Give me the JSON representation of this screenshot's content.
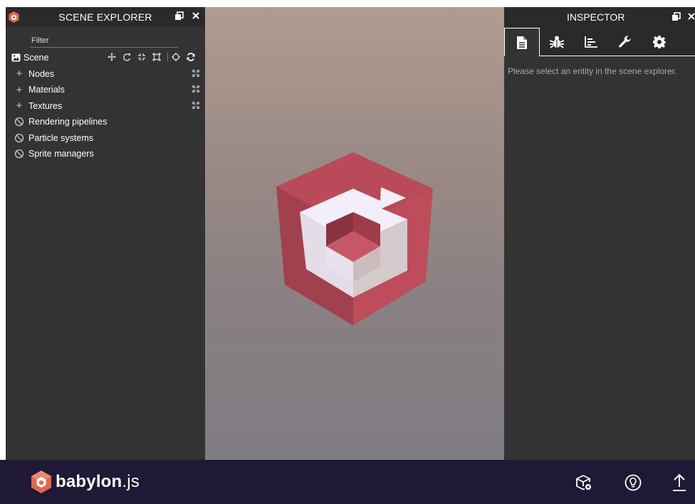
{
  "explorer": {
    "title": "SCENE EXPLORER",
    "filter_placeholder": "Filter",
    "scene_label": "Scene",
    "scene_tools": [
      "move-icon",
      "rotate-icon",
      "scale-icon",
      "bounding-box-icon",
      "target-icon",
      "refresh-icon"
    ],
    "items": [
      {
        "label": "Nodes",
        "type": "expandable"
      },
      {
        "label": "Materials",
        "type": "expandable"
      },
      {
        "label": "Textures",
        "type": "expandable"
      },
      {
        "label": "Rendering pipelines",
        "type": "disabled"
      },
      {
        "label": "Particle systems",
        "type": "disabled"
      },
      {
        "label": "Sprite managers",
        "type": "disabled"
      }
    ]
  },
  "inspector": {
    "title": "INSPECTOR",
    "tabs": [
      "properties-tab",
      "debug-tab",
      "statistics-tab",
      "tools-tab",
      "settings-tab"
    ],
    "active_tab": "properties-tab",
    "empty_message": "Please select an entity in the scene explorer."
  },
  "footer": {
    "brand_bold": "babylon",
    "brand_suffix": ".js",
    "actions": [
      "cube-settings-icon",
      "lightbulb-icon",
      "upload-icon"
    ]
  },
  "colors": {
    "panel_bg": "#333333",
    "header_bg": "#2a2a2a",
    "footer_bg": "#201936",
    "logo_red": "#e0684b",
    "cube_red": "#b74a57",
    "cube_white": "#f4f1fb",
    "accent_blue": "#1f9ed8"
  }
}
